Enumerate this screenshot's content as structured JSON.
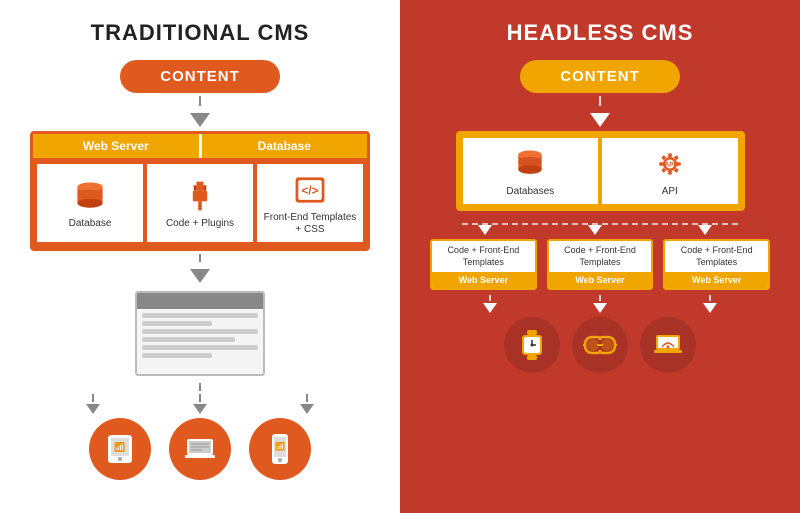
{
  "left": {
    "title": "TRADITIONAL CMS",
    "content_label": "CONTENT",
    "server_label": "Web Server",
    "database_label": "Database",
    "icon1_label": "Database",
    "icon2_label": "Code + Plugins",
    "icon3_label": "Front-End Templates + CSS",
    "devices": [
      "tablet",
      "laptop",
      "mobile"
    ]
  },
  "right": {
    "title": "HEADLESS CMS",
    "content_label": "CONTENT",
    "db_label": "Databases",
    "api_label": "API",
    "ws_content": "Code + Front-End Templates",
    "ws_label": "Web Server",
    "devices": [
      "smartwatch",
      "ar-glasses",
      "laptop"
    ]
  }
}
